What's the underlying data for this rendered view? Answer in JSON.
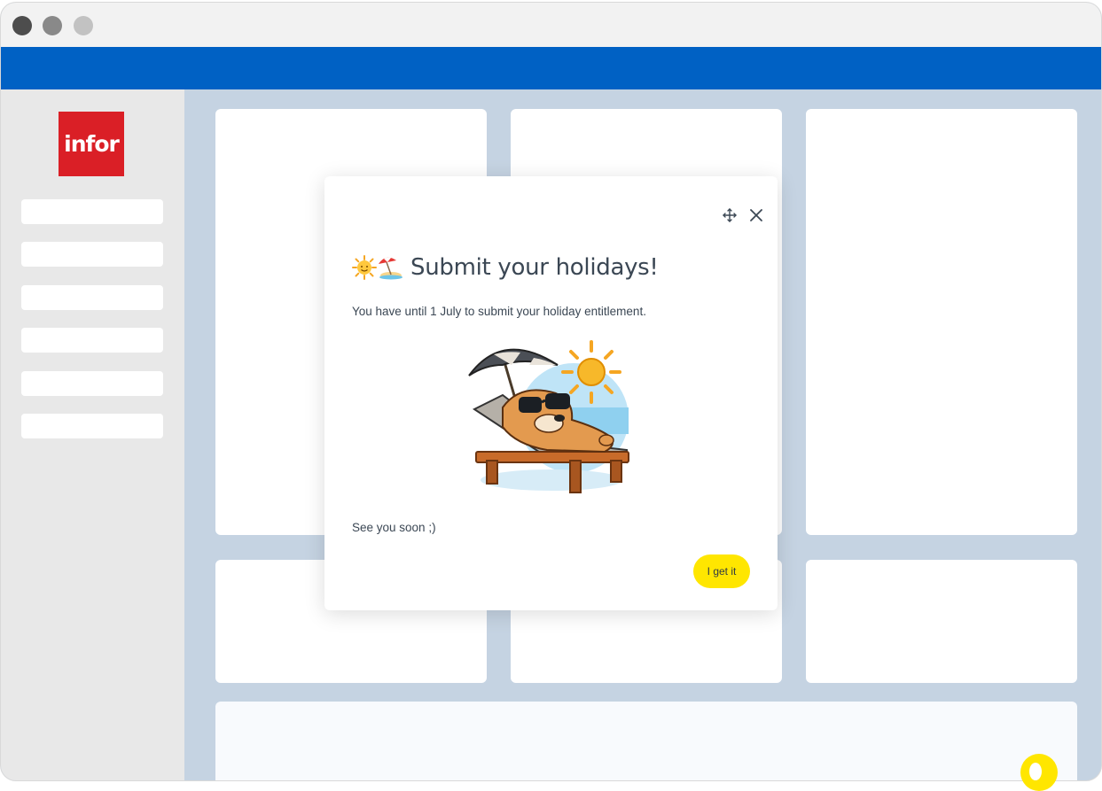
{
  "app": {
    "logo_text": "infor",
    "brand_color": "#da1f26",
    "topbar_color": "#0061c4"
  },
  "sidebar": {
    "items": [
      "",
      "",
      "",
      "",
      "",
      ""
    ]
  },
  "modal": {
    "title": "Submit your holidays!",
    "title_emojis": [
      "sun-with-face-icon",
      "beach-umbrella-icon"
    ],
    "body": "You have until 1 July to submit your holiday entitlement.",
    "closing": "See you soon ;)",
    "cta_label": "I get it",
    "cta_color": "#ffe600",
    "icons": [
      "move-icon",
      "close-icon"
    ]
  }
}
